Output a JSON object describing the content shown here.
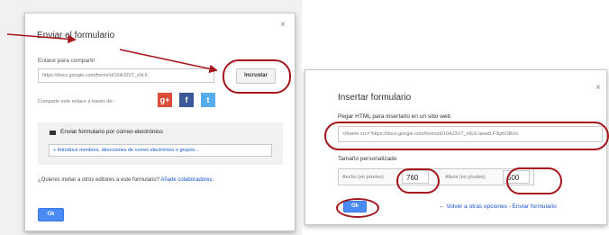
{
  "left_dialog": {
    "title": "Enviar el formulario",
    "close": "×",
    "link_label": "Enlace para compartir",
    "link_value": "https://docs.google.com/forms/d/10AJ3V7_x9L6",
    "embed_button": "Incrustar",
    "share_text": "Comparte este enlace a través de:",
    "social": [
      "g+",
      "f",
      "t"
    ],
    "email_header": "Enviar formulario por correo electrónico",
    "email_placeholder": "+ Introducir nombres, direcciones de correo electrónico o grupos...",
    "invite_text": "¿Quieres invitar a otros editores a este formulario?",
    "invite_link": "Añade colaboradores.",
    "ok": "Ok"
  },
  "right_dialog": {
    "title": "Insertar formulario",
    "close": "×",
    "html_label": "Pegar HTML para insertarlo en un sitio web",
    "html_value": "<iframe src=\"https://docs.google.com/forms/d/10AJ3V7_x9L6-awwtLF3iphOBUs",
    "custom_size_label": "Tamaño personalizado",
    "width_label": "Ancho (en píxeles)",
    "width_value": "760",
    "height_label": "Altura (en píxeles)",
    "height_value": "500",
    "ok": "Ok",
    "back_link": "Volver a otras opciones - Enviar formulario"
  },
  "colors": {
    "annotation": "#a4161c",
    "ok_blue": "#4a8af4",
    "link_blue": "#1155cc",
    "google_plus": "#dd4b39",
    "facebook": "#3b5998",
    "twitter": "#55acee"
  }
}
